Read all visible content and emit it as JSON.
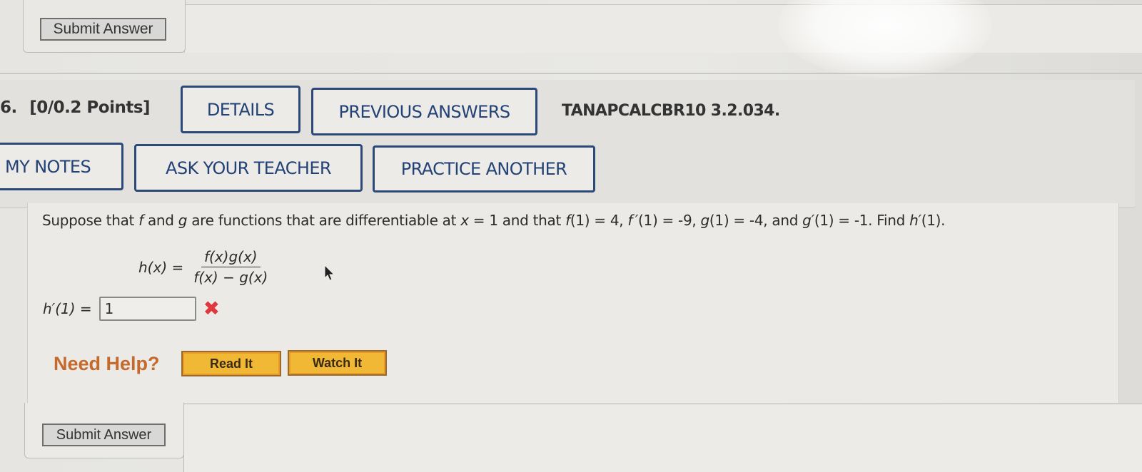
{
  "top": {
    "submit_label": "Submit Answer"
  },
  "question": {
    "number": "6.",
    "points": "[0/0.2 Points]",
    "code": "TANAPCALCBR10 3.2.034.",
    "buttons": {
      "details": "DETAILS",
      "previous_answers": "PREVIOUS ANSWERS",
      "my_notes": "MY NOTES",
      "ask_teacher": "ASK YOUR TEACHER",
      "practice_another": "PRACTICE ANOTHER"
    },
    "prompt": {
      "p1": "Suppose that ",
      "f": "f",
      "p2": " and ",
      "g": "g",
      "p3": " are functions that are differentiable at ",
      "x": "x",
      "p4": " = 1 and that ",
      "f1": "f",
      "p5": "(1) = 4, ",
      "fp": "f ′",
      "p6": "(1) = -9, ",
      "g1": "g",
      "p7": "(1) = -4, and ",
      "gp": "g′",
      "p8": "(1) = -1. Find ",
      "hp": "h′",
      "p9": "(1)."
    },
    "formula": {
      "lhs": "h(x) =",
      "numerator": "f(x)g(x)",
      "denominator": "f(x) − g(x)"
    },
    "answer": {
      "label": "h′(1) =",
      "value": "1",
      "status": "incorrect",
      "status_icon": "✖"
    },
    "help": {
      "label": "Need Help?",
      "read_it": "Read It",
      "watch_it": "Watch It"
    },
    "submit_label": "Submit Answer"
  },
  "colors": {
    "nav_button": "#234276",
    "help_text": "#c56a2c",
    "help_button": "#f0b834",
    "wrong": "#e0383c"
  }
}
